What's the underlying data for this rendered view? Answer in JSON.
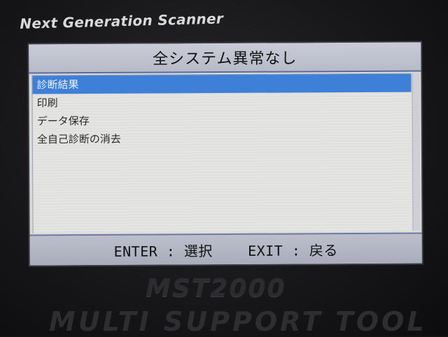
{
  "device": {
    "brand": "Next Generation Scanner",
    "model": "MST2000",
    "tagline": "MULTI SUPPORT TOOL"
  },
  "screen": {
    "title": "全システム異常なし",
    "menu_items": [
      {
        "label": "診断結果",
        "selected": true
      },
      {
        "label": "印刷",
        "selected": false
      },
      {
        "label": "データ保存",
        "selected": false
      },
      {
        "label": "全自己診断の消去",
        "selected": false
      }
    ],
    "footer": {
      "enter_key": "ENTER",
      "enter_action": "選択",
      "exit_key": "EXIT",
      "exit_action": "戻る"
    }
  },
  "colors": {
    "selection": "#3e7fd8",
    "title_bar": "#c2c5d0",
    "screen_bg": "#e2e2e0"
  }
}
